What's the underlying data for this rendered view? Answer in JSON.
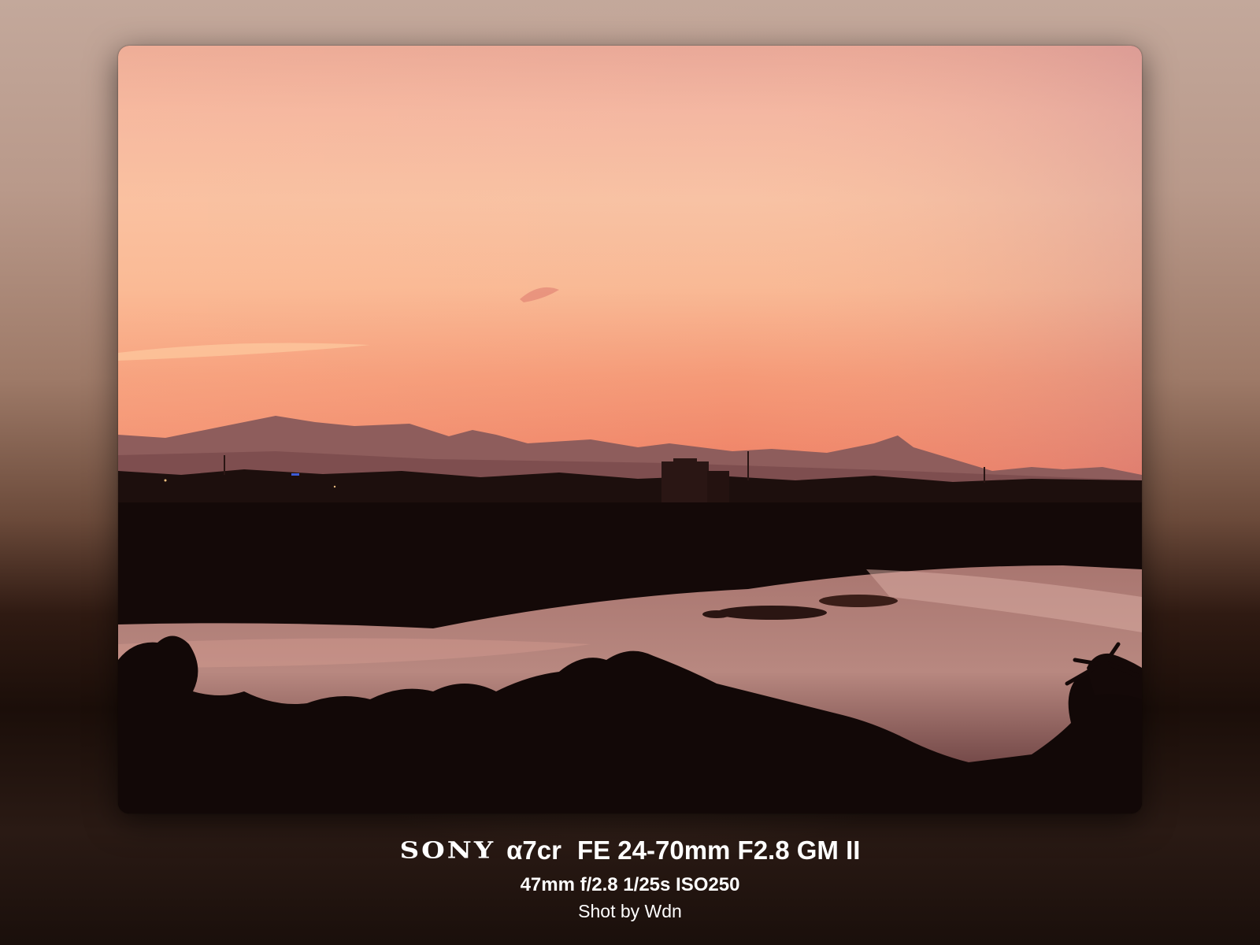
{
  "photo": {
    "subject": "sunset-over-river-with-mountains-silhouette"
  },
  "caption": {
    "brand": "SONY",
    "model": "α7cr",
    "lens": "FE 24-70mm F2.8 GM II",
    "exposure": "47mm f/2.8 1/25s ISO250",
    "credit": "Shot by Wdn"
  },
  "colors": {
    "sky_top": "#e8a596",
    "sky_mid": "#f7b89a",
    "sky_horizon": "#f38a6a",
    "mountains": "#8f5a5a",
    "treeline": "#1a0d0b",
    "river": "#b9867f",
    "caption_text": "#ffffff"
  }
}
